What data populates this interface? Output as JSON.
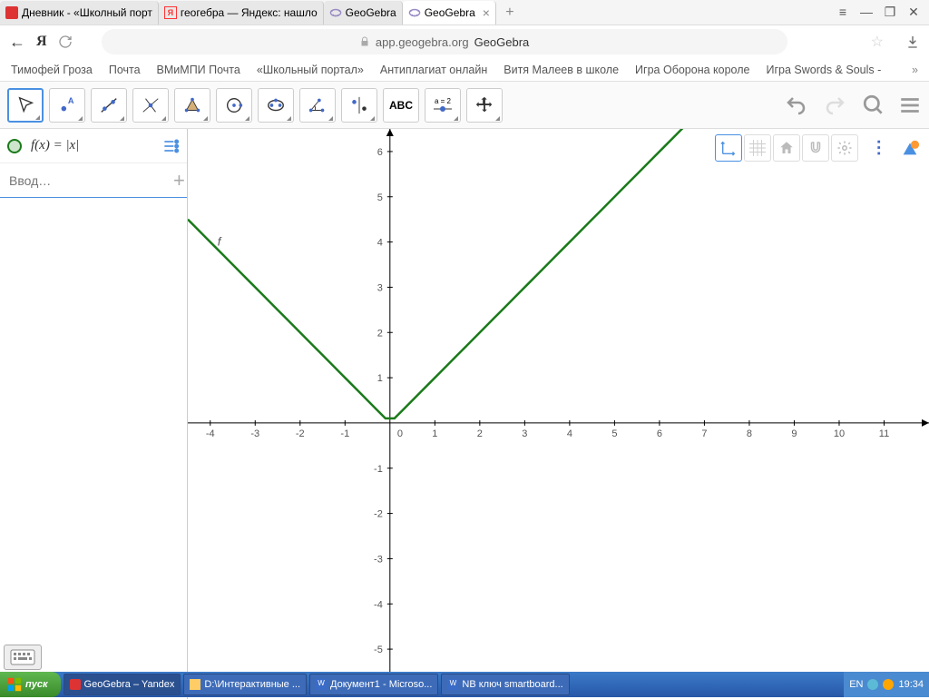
{
  "browser": {
    "tabs": [
      {
        "label": "Дневник - «Школный порт"
      },
      {
        "label": "геогебра — Яндекс: нашло"
      },
      {
        "label": "GeoGebra"
      },
      {
        "label": "GeoGebra"
      }
    ],
    "url_host": "app.geogebra.org",
    "url_title": "GeoGebra"
  },
  "bookmarks": [
    "Тимофей Гроза",
    "Почта",
    "ВМиМПИ Почта",
    "«Школьный портал»",
    "Антиплагиат онлайн",
    "Витя Малеев в школе",
    "Игра Оборона короле",
    "Игра Swords & Souls -"
  ],
  "toolbar": {
    "text_tool": "ABC",
    "slider_tool": "a = 2"
  },
  "algebra": {
    "formula": "f(x) = |x|",
    "input_placeholder": "Ввод…"
  },
  "chart_data": {
    "type": "line",
    "title": "",
    "xlabel": "",
    "ylabel": "",
    "xlim": [
      -4.5,
      12
    ],
    "ylim": [
      -5.5,
      6.5
    ],
    "x_ticks": [
      -4,
      -3,
      -2,
      -1,
      0,
      1,
      2,
      3,
      4,
      5,
      6,
      7,
      8,
      9,
      10,
      11
    ],
    "y_ticks": [
      -5,
      -4,
      -3,
      -2,
      -1,
      1,
      2,
      3,
      4,
      5,
      6
    ],
    "series": [
      {
        "name": "f",
        "color": "#1a7a1a",
        "x": [
          -4.5,
          -4,
          -3,
          -2,
          -1,
          0,
          1,
          2,
          3,
          4,
          5,
          6,
          7
        ],
        "y": [
          4.5,
          4,
          3,
          2,
          1,
          0,
          1,
          2,
          3,
          4,
          5,
          6,
          7
        ]
      }
    ]
  },
  "graph": {
    "xrange": [
      -4.5,
      12
    ],
    "yrange": [
      -5.5,
      6.5
    ],
    "xticks": [
      -4,
      -3,
      -2,
      -1,
      1,
      2,
      3,
      4,
      5,
      6,
      7,
      8,
      9,
      10,
      11
    ],
    "yticks": [
      -5,
      -4,
      -3,
      -2,
      -1,
      1,
      2,
      3,
      4,
      5,
      6
    ],
    "origin_label": "0",
    "fn_label": "f"
  },
  "taskbar": {
    "start": "пуск",
    "items": [
      "GeoGebra – Yandex",
      "D:\\Интерактивные ...",
      "Документ1 - Microso...",
      "NB ключ smartboard..."
    ],
    "lang": "EN",
    "time": "19:34"
  }
}
